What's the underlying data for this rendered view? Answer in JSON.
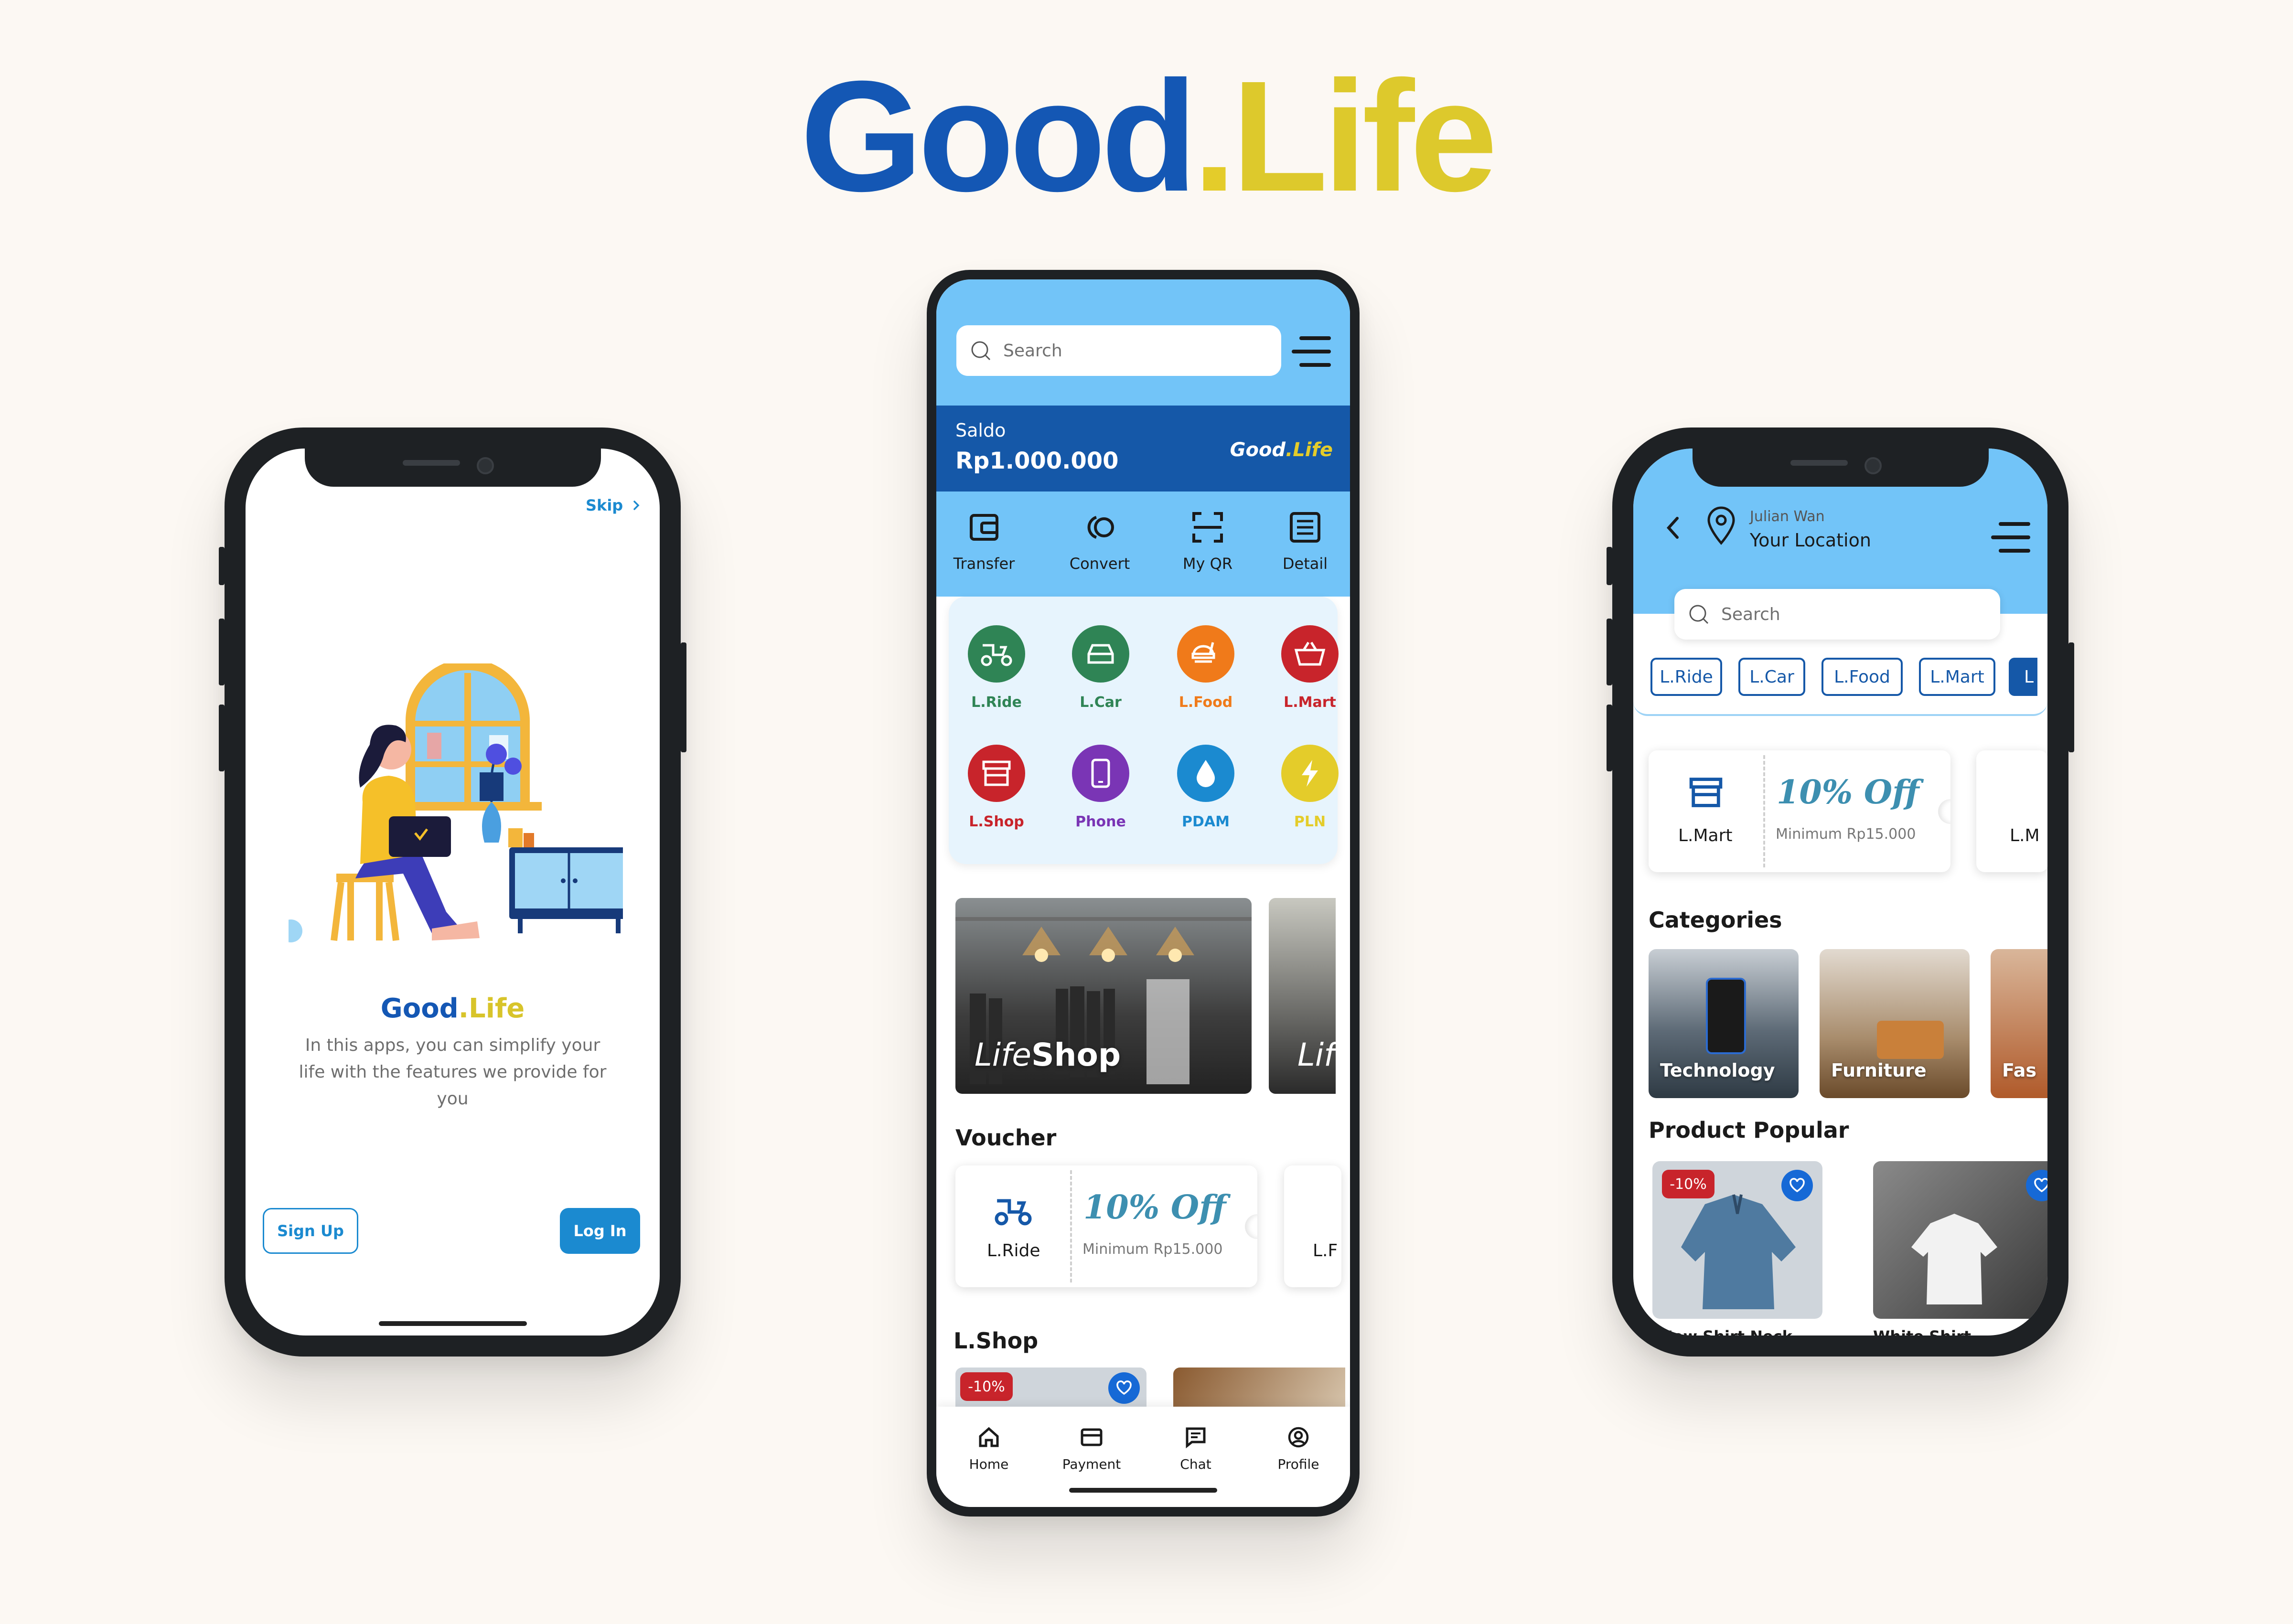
{
  "brand": {
    "good": "Good",
    "dot": ".",
    "life": "Life"
  },
  "colors": {
    "primary": "#1558a8",
    "accent": "#72c4f8",
    "yellow": "#e4cc2a",
    "button": "#1b8ad0"
  },
  "onboarding": {
    "skip_label": "Skip",
    "logo_good": "Good",
    "logo_life": ".Life",
    "description": "In this apps, you can simplify your life with the features we provide for you",
    "signup_label": "Sign Up",
    "login_label": "Log In"
  },
  "home": {
    "search_placeholder": "Search",
    "saldo_label": "Saldo",
    "saldo_value": "Rp1.000.000",
    "brand_good": "Good",
    "brand_life": ".Life",
    "actions": [
      {
        "label": "Transfer",
        "icon": "wallet-icon"
      },
      {
        "label": "Convert",
        "icon": "convert-icon"
      },
      {
        "label": "My QR",
        "icon": "qr-icon"
      },
      {
        "label": "Detail",
        "icon": "detail-icon"
      }
    ],
    "services": [
      {
        "label": "L.Ride",
        "icon": "scooter-icon",
        "color": "#2f8455"
      },
      {
        "label": "L.Car",
        "icon": "car-icon",
        "color": "#2f8455"
      },
      {
        "label": "L.Food",
        "icon": "food-icon",
        "color": "#f07a1a"
      },
      {
        "label": "L.Mart",
        "icon": "basket-icon",
        "color": "#c8242b"
      },
      {
        "label": "L.Shop",
        "icon": "shop-icon",
        "color": "#c8242b"
      },
      {
        "label": "Phone",
        "icon": "phone-icon",
        "color": "#7a35b5"
      },
      {
        "label": "PDAM",
        "icon": "water-icon",
        "color": "#1b8ad0"
      },
      {
        "label": "PLN",
        "icon": "bolt-icon",
        "color": "#e4cc2a"
      }
    ],
    "banner_life": "Life",
    "banner_shop": "Shop",
    "banner2_text": "Lif",
    "voucher_title": "Voucher",
    "voucher": {
      "service": "L.Ride",
      "offer": "10% Off",
      "min": "Minimum Rp15.000",
      "next_service": "L.F"
    },
    "lshop_title": "L.Shop",
    "lshop_discount": "-10%",
    "nav": [
      {
        "label": "Home",
        "icon": "home-icon"
      },
      {
        "label": "Payment",
        "icon": "card-icon"
      },
      {
        "label": "Chat",
        "icon": "chat-icon"
      },
      {
        "label": "Profile",
        "icon": "profile-icon"
      }
    ]
  },
  "shop": {
    "user_name": "Julian Wan",
    "location_label": "Your Location",
    "search_placeholder": "Search",
    "chips": [
      "L.Ride",
      "L.Car",
      "L.Food",
      "L.Mart",
      "L"
    ],
    "voucher": {
      "service": "L.Mart",
      "offer": "10% Off",
      "min": "Minimum Rp15.000",
      "next_service": "L.M"
    },
    "categories_title": "Categories",
    "categories": [
      "Technology",
      "Furniture",
      "Fas"
    ],
    "popular_title": "Product Popular",
    "products": [
      {
        "name": "New Shirt Neck",
        "discount": "-10%"
      },
      {
        "name": "White Shirt"
      }
    ]
  }
}
